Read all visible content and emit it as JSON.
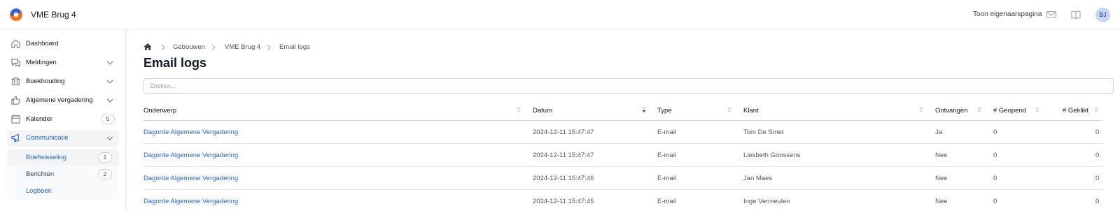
{
  "app": {
    "title": "VME Brug 4"
  },
  "topbar": {
    "owner_link": "Toon eigenaarspagina",
    "avatar_initials": "BJ"
  },
  "colors": {
    "accent": "#2563eb",
    "avatar_bg": "#c7d7fb",
    "logo_blue": "#2563eb",
    "logo_orange": "#f97316"
  },
  "sidebar": {
    "items": [
      {
        "label": "Dashboard",
        "icon": "home-icon"
      },
      {
        "label": "Meldingen",
        "icon": "chat-icon",
        "expandable": true
      },
      {
        "label": "Boekhouding",
        "icon": "bank-icon",
        "expandable": true
      },
      {
        "label": "Algemene vergadering",
        "icon": "thumbs-up-icon",
        "expandable": true
      },
      {
        "label": "Kalender",
        "icon": "calendar-icon",
        "count": "5"
      },
      {
        "label": "Communicatie",
        "icon": "megaphone-icon",
        "expandable": true,
        "active": true
      }
    ],
    "sub_items": [
      {
        "label": "Briefwisseling",
        "count": "1"
      },
      {
        "label": "Berichten",
        "count": "2"
      },
      {
        "label": "Logboek"
      }
    ]
  },
  "breadcrumb": [
    "Gebouwen",
    "VME Brug 4",
    "Email logs"
  ],
  "page": {
    "title": "Email logs"
  },
  "search": {
    "placeholder": "Zoeken..."
  },
  "table": {
    "columns": [
      "Onderwerp",
      "Datum",
      "Type",
      "Klant",
      "Ontvangen",
      "# Geopend",
      "# Geklikt"
    ],
    "rows": [
      [
        "Dagorde Algemene Vergadering",
        "2024-12-11 15:47:47",
        "E-mail",
        "Tom De Smet",
        "Ja",
        "0",
        "0"
      ],
      [
        "Dagorde Algemene Vergadering",
        "2024-12-11 15:47:47",
        "E-mail",
        "Liesbeth Goossens",
        "Nee",
        "0",
        "0"
      ],
      [
        "Dagorde Algemene Vergadering",
        "2024-12-11 15:47:46",
        "E-mail",
        "Jan Maes",
        "Nee",
        "0",
        "0"
      ],
      [
        "Dagorde Algemene Vergadering",
        "2024-12-11 15:47:45",
        "E-mail",
        "Inge Vermeulen",
        "Nee",
        "0",
        "0"
      ]
    ]
  }
}
